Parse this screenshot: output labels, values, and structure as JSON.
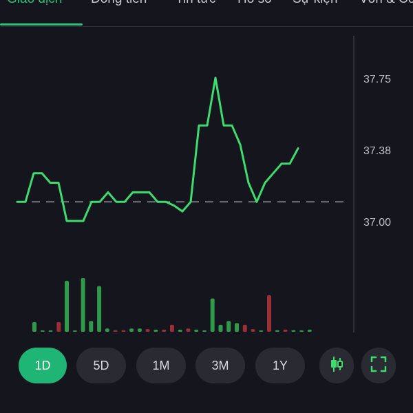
{
  "tabs": [
    {
      "label": "Giao dịch",
      "active": true
    },
    {
      "label": "Dòng tiền"
    },
    {
      "label": "Tin tức"
    },
    {
      "label": "Hồ sơ"
    },
    {
      "label": "Sự kiện"
    },
    {
      "label": "Vốn & Cổ"
    }
  ],
  "price_axis": {
    "labels": [
      "37.75",
      "37.38",
      "37.00"
    ],
    "values": [
      37.75,
      37.38,
      37.0
    ]
  },
  "colors": {
    "accent": "#22c47a",
    "line": "#3ddc6e",
    "volume_up": "#2f9a4a",
    "volume_down": "#9a2f35",
    "reference": "#9a9aa2"
  },
  "chart_data": {
    "type": "line",
    "reference_price": 37.1,
    "ylim": [
      36.85,
      37.9
    ],
    "price_series": [
      37.1,
      37.1,
      37.25,
      37.25,
      37.2,
      37.2,
      37.0,
      37.0,
      37.0,
      37.1,
      37.1,
      37.15,
      37.1,
      37.1,
      37.15,
      37.15,
      37.15,
      37.1,
      37.1,
      37.08,
      37.05,
      37.1,
      37.5,
      37.5,
      37.75,
      37.5,
      37.5,
      37.4,
      37.2,
      37.1,
      37.2,
      37.25,
      37.3,
      37.3,
      37.38
    ],
    "volume": [
      {
        "v": 0.18,
        "d": "up"
      },
      {
        "v": 0.0,
        "d": "up"
      },
      {
        "v": 0.0,
        "d": "up"
      },
      {
        "v": 0.18,
        "d": "down"
      },
      {
        "v": 0.95,
        "d": "up"
      },
      {
        "v": 0.0,
        "d": "up"
      },
      {
        "v": 1.0,
        "d": "up"
      },
      {
        "v": 0.2,
        "d": "up"
      },
      {
        "v": 0.85,
        "d": "up"
      },
      {
        "v": 0.06,
        "d": "up"
      },
      {
        "v": 0.03,
        "d": "down"
      },
      {
        "v": 0.03,
        "d": "down"
      },
      {
        "v": 0.06,
        "d": "up"
      },
      {
        "v": 0.06,
        "d": "up"
      },
      {
        "v": 0.05,
        "d": "down"
      },
      {
        "v": 0.04,
        "d": "up"
      },
      {
        "v": 0.04,
        "d": "down"
      },
      {
        "v": 0.13,
        "d": "down"
      },
      {
        "v": 0.04,
        "d": "up"
      },
      {
        "v": 0.06,
        "d": "down"
      },
      {
        "v": 0.04,
        "d": "up"
      },
      {
        "v": 0.0,
        "d": "up"
      },
      {
        "v": 0.62,
        "d": "up"
      },
      {
        "v": 0.13,
        "d": "up"
      },
      {
        "v": 0.2,
        "d": "up"
      },
      {
        "v": 0.16,
        "d": "up"
      },
      {
        "v": 0.13,
        "d": "down"
      },
      {
        "v": 0.05,
        "d": "down"
      },
      {
        "v": 0.02,
        "d": "up"
      },
      {
        "v": 0.68,
        "d": "down"
      },
      {
        "v": 0.03,
        "d": "up"
      },
      {
        "v": 0.04,
        "d": "down"
      },
      {
        "v": 0.03,
        "d": "up"
      },
      {
        "v": 0.0,
        "d": "up"
      },
      {
        "v": 0.04,
        "d": "up"
      }
    ]
  },
  "range_buttons": [
    {
      "label": "1D",
      "active": true
    },
    {
      "label": "5D"
    },
    {
      "label": "1M"
    },
    {
      "label": "3M"
    },
    {
      "label": "1Y"
    }
  ],
  "icons": {
    "candlestick": "candlestick-icon",
    "fullscreen": "fullscreen-icon"
  }
}
